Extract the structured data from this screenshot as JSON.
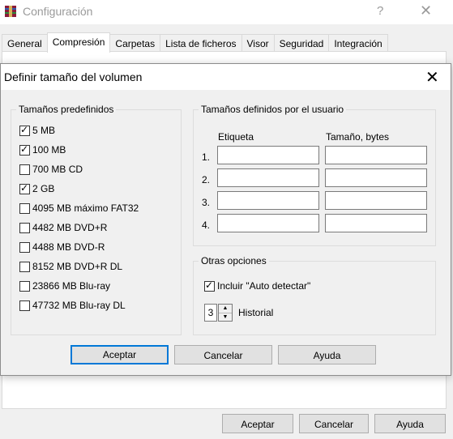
{
  "parent_window": {
    "title": "Configuración",
    "help_glyph": "?",
    "close_glyph": "✕",
    "tabs": [
      {
        "label": "General"
      },
      {
        "label": "Compresión",
        "active": true
      },
      {
        "label": "Carpetas"
      },
      {
        "label": "Lista de ficheros"
      },
      {
        "label": "Visor"
      },
      {
        "label": "Seguridad"
      },
      {
        "label": "Integración"
      }
    ],
    "buttons": {
      "accept": "Aceptar",
      "cancel": "Cancelar",
      "help": "Ayuda"
    }
  },
  "dialog": {
    "title": "Definir tamaño del volumen",
    "close_glyph": "✕",
    "predefined": {
      "label": "Tamaños predefinidos",
      "items": [
        {
          "label": "5 MB",
          "checked": true
        },
        {
          "label": "100 MB",
          "checked": true
        },
        {
          "label": "700 MB CD",
          "checked": false
        },
        {
          "label": "2 GB",
          "checked": true
        },
        {
          "label": "4095 MB máximo FAT32",
          "checked": false
        },
        {
          "label": "4482 MB DVD+R",
          "checked": false
        },
        {
          "label": "4488 MB DVD-R",
          "checked": false
        },
        {
          "label": "8152 MB DVD+R DL",
          "checked": false
        },
        {
          "label": "23866 MB Blu-ray",
          "checked": false
        },
        {
          "label": "47732 MB Blu-ray DL",
          "checked": false
        }
      ]
    },
    "user_defined": {
      "label": "Tamaños definidos por el usuario",
      "col_label": "Etiqueta",
      "col_size": "Tamaño, bytes",
      "rows": [
        {
          "num": "1.",
          "label_value": "",
          "size_value": ""
        },
        {
          "num": "2.",
          "label_value": "",
          "size_value": ""
        },
        {
          "num": "3.",
          "label_value": "",
          "size_value": ""
        },
        {
          "num": "4.",
          "label_value": "",
          "size_value": ""
        }
      ]
    },
    "other_options": {
      "label": "Otras opciones",
      "auto_detect_label": "Incluir \"Auto detectar\"",
      "auto_detect_checked": true,
      "history_value": "3",
      "history_label": "Historial"
    },
    "buttons": {
      "accept": "Aceptar",
      "cancel": "Cancelar",
      "help": "Ayuda"
    }
  },
  "colors": {
    "accent": "#0078d7",
    "background": "#f0f0f0"
  }
}
